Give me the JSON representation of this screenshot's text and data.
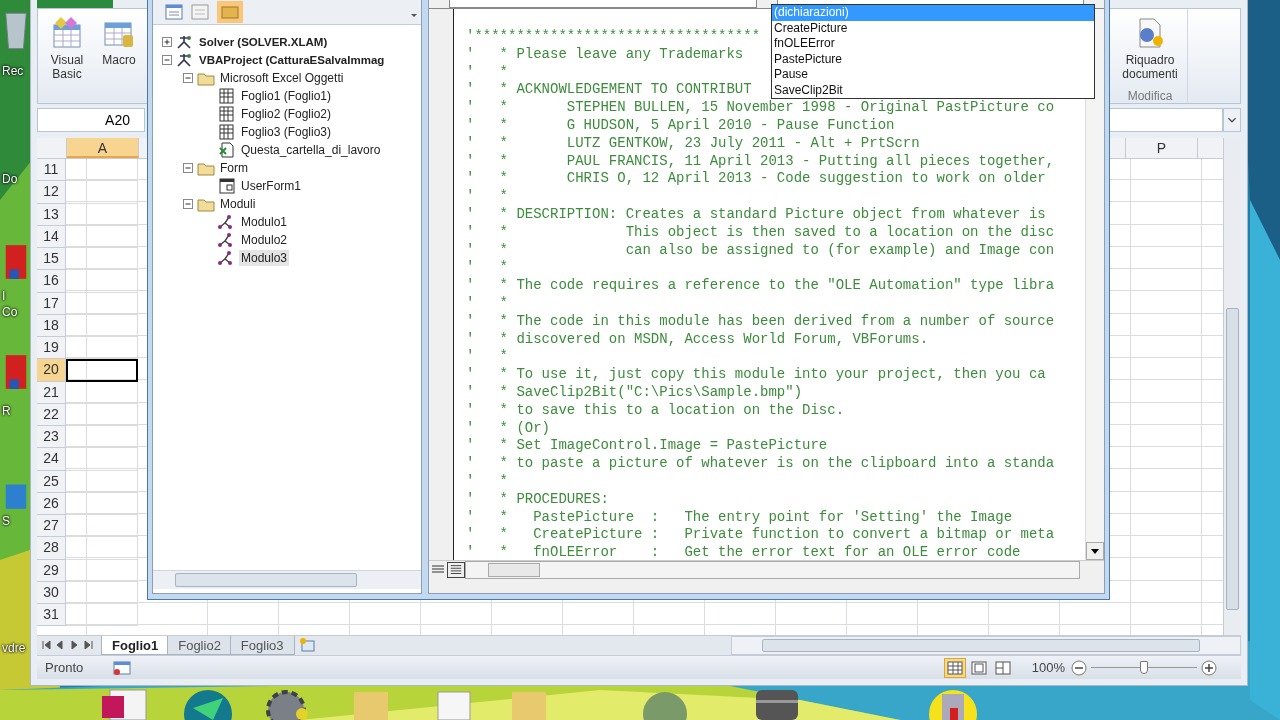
{
  "desktop": {
    "labels": [
      "Rec",
      "Do",
      "I",
      "Co",
      "R",
      "S",
      "vdre"
    ]
  },
  "excel": {
    "ribbon": {
      "buttons": [
        {
          "kind": "vba",
          "label": "Visual Basic"
        },
        {
          "kind": "macro",
          "label": "Macro"
        }
      ],
      "document_pane": {
        "label": "Riquadro documenti",
        "group": "Modifica"
      }
    },
    "name_box": "A20",
    "columns": [
      {
        "label": "A",
        "selected": true
      },
      {
        "label": "P",
        "selected": false
      }
    ],
    "rows": [
      {
        "label": "11",
        "selected": false
      },
      {
        "label": "12",
        "selected": false
      },
      {
        "label": "13",
        "selected": false
      },
      {
        "label": "14",
        "selected": false
      },
      {
        "label": "15",
        "selected": false
      },
      {
        "label": "16",
        "selected": false
      },
      {
        "label": "17",
        "selected": false
      },
      {
        "label": "18",
        "selected": false
      },
      {
        "label": "19",
        "selected": false
      },
      {
        "label": "20",
        "selected": true
      },
      {
        "label": "21",
        "selected": false
      },
      {
        "label": "22",
        "selected": false
      },
      {
        "label": "23",
        "selected": false
      },
      {
        "label": "24",
        "selected": false
      },
      {
        "label": "25",
        "selected": false
      },
      {
        "label": "26",
        "selected": false
      },
      {
        "label": "27",
        "selected": false
      },
      {
        "label": "28",
        "selected": false
      },
      {
        "label": "29",
        "selected": false
      },
      {
        "label": "30",
        "selected": false
      },
      {
        "label": "31",
        "selected": false
      }
    ],
    "sheet_tabs": [
      {
        "label": "Foglio1",
        "selected": true
      },
      {
        "label": "Foglio2",
        "selected": false
      },
      {
        "label": "Foglio3",
        "selected": false
      }
    ],
    "status": "Pronto",
    "view_buttons": [
      {
        "kind": "normal",
        "selected": true
      },
      {
        "kind": "layout",
        "selected": false
      },
      {
        "kind": "pagebreak",
        "selected": false
      }
    ],
    "zoom": {
      "reading": "100%",
      "level": 0.5
    }
  },
  "vbe": {
    "project_tree": [
      {
        "label": "Solver (SOLVER.XLAM)",
        "kind": "project",
        "expanded": false,
        "selected": false
      },
      {
        "label": "VBAProject (CatturaESalvaImmag",
        "kind": "project",
        "expanded": true,
        "selected": false,
        "children": [
          {
            "label": "Microsoft Excel Oggetti",
            "kind": "folder",
            "expanded": true,
            "selected": false,
            "children": [
              {
                "label": "Foglio1 (Foglio1)",
                "kind": "sheet",
                "selected": false
              },
              {
                "label": "Foglio2 (Foglio2)",
                "kind": "sheet",
                "selected": false
              },
              {
                "label": "Foglio3 (Foglio3)",
                "kind": "sheet",
                "selected": false
              },
              {
                "label": "Questa_cartella_di_lavoro",
                "kind": "workbook",
                "selected": false
              }
            ]
          },
          {
            "label": "Form",
            "kind": "folder",
            "expanded": true,
            "selected": false,
            "children": [
              {
                "label": "UserForm1",
                "kind": "form",
                "selected": false
              }
            ]
          },
          {
            "label": "Moduli",
            "kind": "folder",
            "expanded": true,
            "selected": false,
            "children": [
              {
                "label": "Modulo1",
                "kind": "module",
                "selected": false
              },
              {
                "label": "Modulo2",
                "kind": "module",
                "selected": false
              },
              {
                "label": "Modulo3",
                "kind": "module",
                "selected": true
              }
            ]
          }
        ]
      }
    ],
    "code_lines": [
      "'**********************************",
      "'   * Please leave any Trademarks",
      "'   *",
      "'   * ACKNOWLEDGEMENT TO CONTRIBUT",
      "'   *       STEPHEN BULLEN, 15 November 1998 - Original PastPicture co",
      "'   *       G HUDSON, 5 April 2010 - Pause Function",
      "'   *       LUTZ GENTKOW, 23 July 2011 - Alt + PrtScrn",
      "'   *       PAUL FRANCIS, 11 April 2013 - Putting all pieces together,",
      "'   *       CHRIS O, 12 April 2013 - Code suggestion to work on older",
      "'   *",
      "'   * DESCRIPTION: Creates a standard Picture object from whatever is",
      "'   *              This object is then saved to a location on the disc",
      "'   *              can also be assigned to (for example) and Image con",
      "'   *",
      "'   * The code requires a reference to the \"OLE Automation\" type libra",
      "'   *",
      "'   * The code in this module has been derived from a number of source",
      "'   * discovered on MSDN, Access World Forum, VBForums.",
      "'   *",
      "'   * To use it, just copy this module into your project, then you ca",
      "'   * SaveClip2Bit(\"C:\\Pics\\Sample.bmp\")",
      "'   * to save this to a location on the Disc.",
      "'   * (Or)",
      "'   * Set ImageControl.Image = PastePicture",
      "'   * to paste a picture of whatever is on the clipboard into a standa",
      "'   *",
      "'   * PROCEDURES:",
      "'   *   PastePicture  :   The entry point for 'Setting' the Image",
      "'   *   CreatePicture :   Private function to convert a bitmap or meta",
      "'   *   fnOLEError    :   Get the error text for an OLE error code"
    ],
    "procedure_list": [
      {
        "label": "(dichiarazioni)",
        "selected": true
      },
      {
        "label": "CreatePicture",
        "selected": false
      },
      {
        "label": "fnOLEError",
        "selected": false
      },
      {
        "label": "PastePicture",
        "selected": false
      },
      {
        "label": "Pause",
        "selected": false
      },
      {
        "label": "SaveClip2Bit",
        "selected": false
      }
    ]
  }
}
